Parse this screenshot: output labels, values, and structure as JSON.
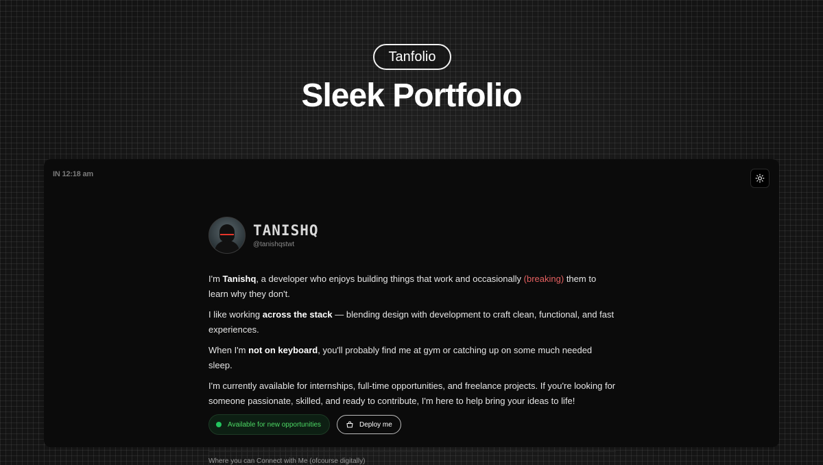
{
  "badge": "Tanfolio",
  "headline": "Sleek Portfolio",
  "clock": "IN 12:18 am",
  "icons": {
    "theme_toggle": "sun-icon",
    "deploy": "bag-icon"
  },
  "profile": {
    "name": "TANISHQ",
    "handle": "@tanishqstwt"
  },
  "bio": {
    "p1": {
      "a": "I'm ",
      "b": "Tanishq",
      "c": ", a developer who enjoys building things that work and occasionally ",
      "d": "(breaking)",
      "e": " them to learn why they don't."
    },
    "p2": {
      "a": "I like working ",
      "b": "across the stack",
      "c": " — blending design with development to craft clean, functional, and fast experiences."
    },
    "p3": {
      "a": "When I'm ",
      "b": "not on keyboard",
      "c": ", you'll probably find me at gym or catching up on some much needed sleep."
    },
    "p4": "I'm currently available for internships, full-time opportunities, and freelance projects. If you're looking for someone passionate, skilled, and ready to contribute, I'm here to help bring your ideas to life!"
  },
  "actions": {
    "status": "Available for new opportunities",
    "deploy": "Deploy me"
  },
  "connect_label": "Where you can Connect with Me (ofcourse digitally)",
  "colors": {
    "accent_red": "#e56060",
    "status_green": "#22c55e"
  }
}
